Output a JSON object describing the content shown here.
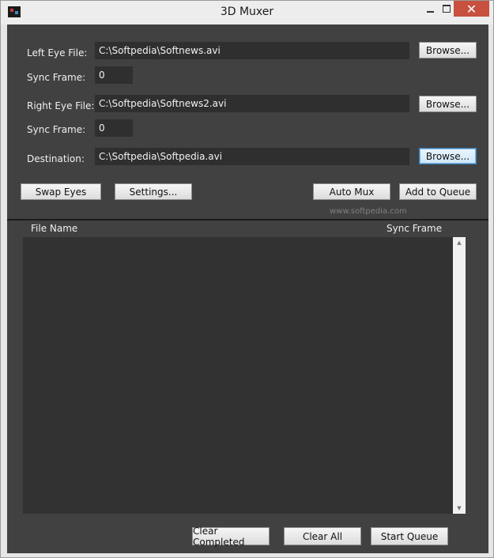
{
  "window": {
    "title": "3D Muxer",
    "controls": {
      "minimize": "—",
      "maximize": "□",
      "close": "✕"
    }
  },
  "left_eye": {
    "label": "Left Eye File:",
    "value": "C:\\Softpedia\\Softnews.avi",
    "browse_label": "Browse...",
    "sync_label": "Sync Frame:",
    "sync_value": "0"
  },
  "right_eye": {
    "label": "Right Eye File:",
    "value": "C:\\Softpedia\\Softnews2.avi",
    "browse_label": "Browse...",
    "sync_label": "Sync Frame:",
    "sync_value": "0"
  },
  "destination": {
    "label": "Destination:",
    "value": "C:\\Softpedia\\Softpedia.avi",
    "browse_label": "Browse..."
  },
  "actions": {
    "swap_eyes": "Swap Eyes",
    "settings": "Settings...",
    "auto_mux": "Auto Mux",
    "add_to_queue": "Add to Queue"
  },
  "watermark": "www.softpedia.com",
  "queue": {
    "columns": [
      "File Name",
      "Sync Frame"
    ],
    "rows": []
  },
  "bottom_buttons": {
    "clear_completed": "Clear Completed",
    "clear_all": "Clear All",
    "start_queue": "Start Queue"
  },
  "colors": {
    "panel": "#414141",
    "field": "#2f2f2f",
    "list": "#323232",
    "close": "#c7503f"
  }
}
